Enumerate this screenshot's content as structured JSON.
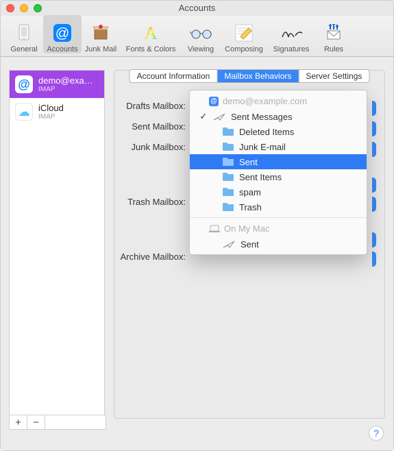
{
  "window": {
    "title": "Accounts"
  },
  "toolbar": {
    "items": [
      {
        "label": "General"
      },
      {
        "label": "Accounts"
      },
      {
        "label": "Junk Mail"
      },
      {
        "label": "Fonts & Colors"
      },
      {
        "label": "Viewing"
      },
      {
        "label": "Composing"
      },
      {
        "label": "Signatures"
      },
      {
        "label": "Rules"
      }
    ],
    "selected_index": 1
  },
  "sidebar": {
    "accounts": [
      {
        "name": "demo@exa…",
        "protocol": "IMAP"
      },
      {
        "name": "iCloud",
        "protocol": "IMAP"
      }
    ],
    "selected_index": 0,
    "add_label": "+",
    "remove_label": "−"
  },
  "tabs": {
    "items": [
      "Account Information",
      "Mailbox Behaviors",
      "Server Settings"
    ],
    "selected_index": 1
  },
  "form": {
    "labels": {
      "drafts": "Drafts Mailbox:",
      "sent": "Sent Mailbox:",
      "junk": "Junk Mailbox:",
      "trash": "Trash Mailbox:",
      "archive": "Archive Mailbox:"
    }
  },
  "popup": {
    "section1_header": "demo@example.com",
    "items1": [
      {
        "label": "Sent Messages",
        "checked": true,
        "icon": "sent"
      },
      {
        "label": "Deleted Items",
        "icon": "folder"
      },
      {
        "label": "Junk E-mail",
        "icon": "folder"
      },
      {
        "label": "Sent",
        "icon": "folder",
        "highlighted": true
      },
      {
        "label": "Sent Items",
        "icon": "folder"
      },
      {
        "label": "spam",
        "icon": "folder"
      },
      {
        "label": "Trash",
        "icon": "folder"
      }
    ],
    "section2_header": "On My Mac",
    "items2": [
      {
        "label": "Sent",
        "icon": "sent"
      }
    ]
  },
  "help": {
    "label": "?"
  }
}
